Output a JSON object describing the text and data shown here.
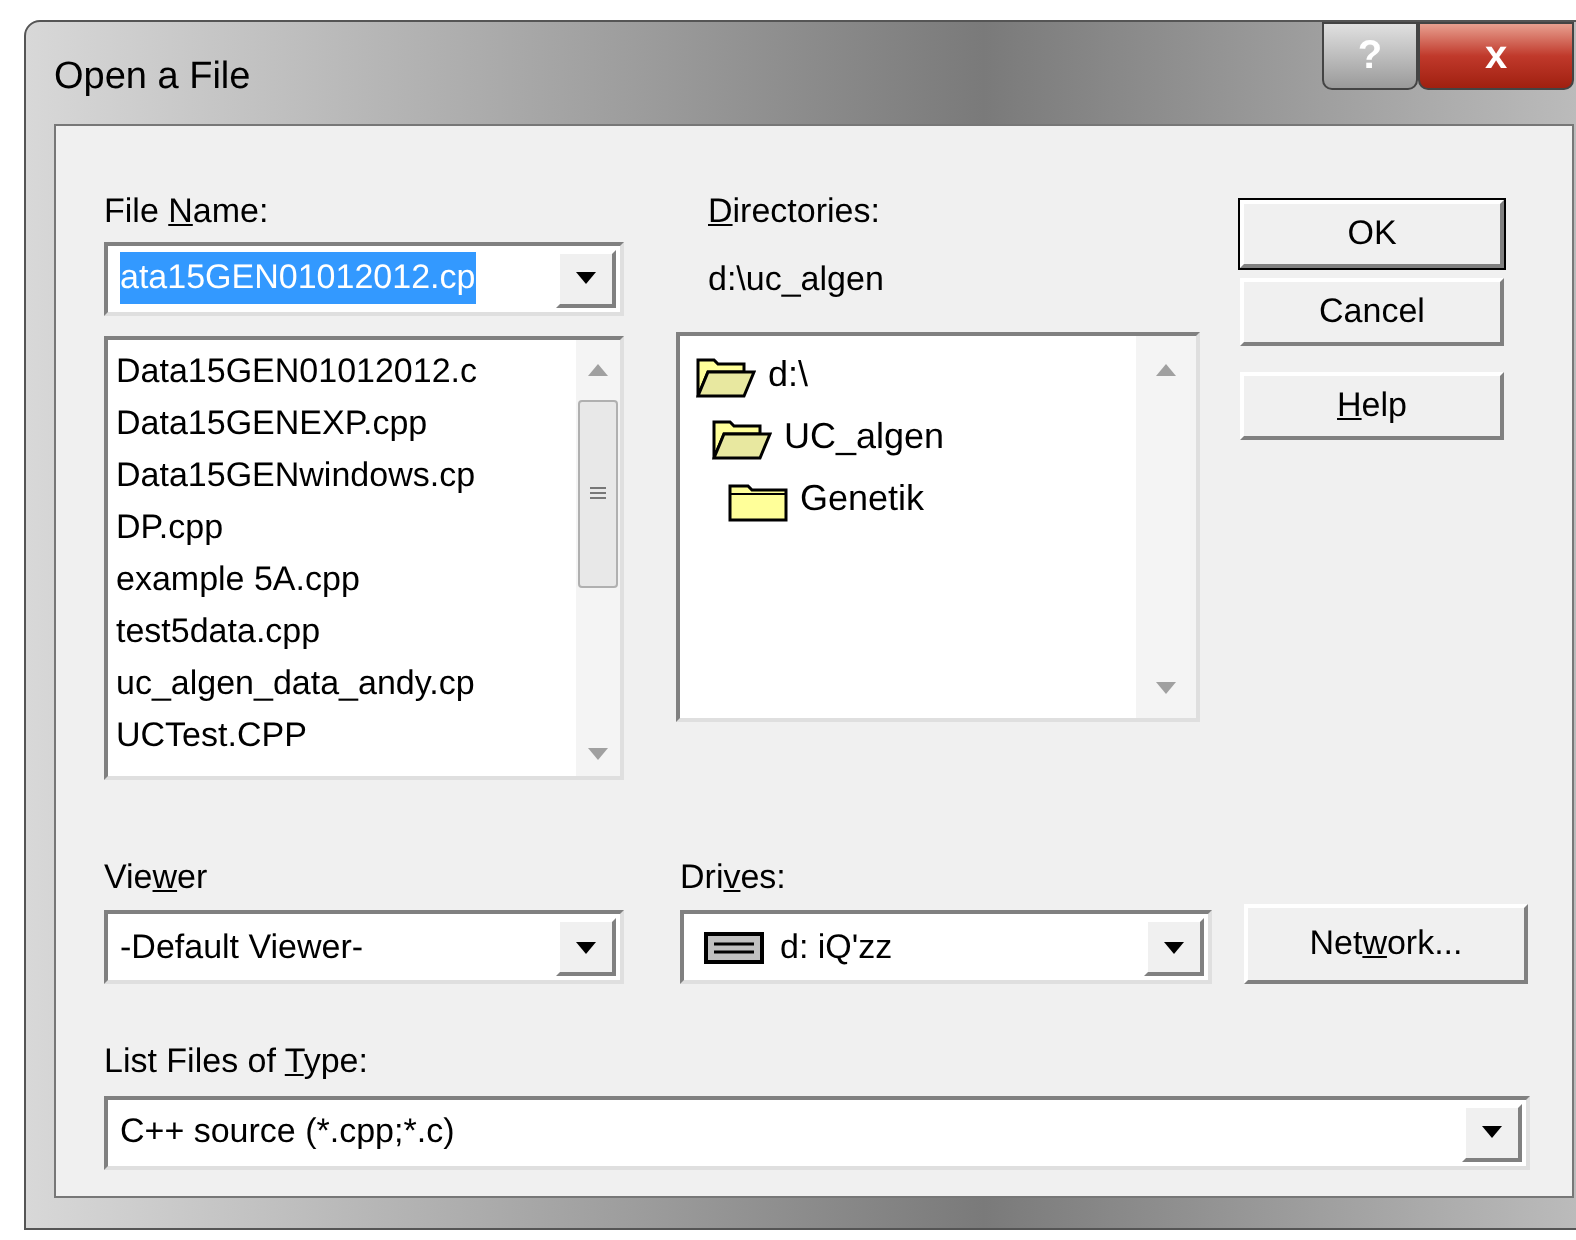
{
  "window": {
    "title": "Open a File",
    "title_buttons": [
      {
        "kind": "help",
        "label": "?"
      },
      {
        "kind": "close",
        "label": "x"
      }
    ]
  },
  "file_name": {
    "label": {
      "pre": "File ",
      "key": "N",
      "post": "ame:"
    },
    "value": "ata15GEN01012012.cp",
    "selected": true
  },
  "files": [
    {
      "name": "Data15GEN01012012.c",
      "selected": false
    },
    {
      "name": "Data15GENEXP.cpp",
      "selected": false
    },
    {
      "name": "Data15GENwindows.cp",
      "selected": false
    },
    {
      "name": "DP.cpp",
      "selected": false
    },
    {
      "name": "example 5A.cpp",
      "selected": false
    },
    {
      "name": "test5data.cpp",
      "selected": false
    },
    {
      "name": "uc_algen_data_andy.cp",
      "selected": false
    },
    {
      "name": "UCTest.CPP",
      "selected": false
    }
  ],
  "directories": {
    "label": {
      "key": "D",
      "post": "irectories:"
    },
    "path": "d:\\uc_algen",
    "tree": [
      {
        "name": "d:\\",
        "expanded": true,
        "children": [
          {
            "name": "UC_algen",
            "expanded": true,
            "children": [
              {
                "name": "Genetik",
                "expanded": false
              }
            ]
          }
        ]
      }
    ]
  },
  "buttons": [
    {
      "label": {
        "post": "OK"
      },
      "default": true
    },
    {
      "label": {
        "post": "Cancel"
      },
      "default": false
    },
    {
      "label": {
        "key": "H",
        "post": "elp"
      },
      "default": false
    }
  ],
  "viewer": {
    "label": {
      "pre": "Vie",
      "key": "w",
      "post": "er"
    },
    "value": "-Default Viewer-"
  },
  "drives": {
    "label": {
      "pre": "Dri",
      "key": "v",
      "post": "es:"
    },
    "value": "d: iQ'zz"
  },
  "network_button": {
    "label": {
      "pre": "Net",
      "key": "w",
      "post": "ork..."
    }
  },
  "file_type": {
    "label": {
      "pre": "List Files of ",
      "key": "T",
      "post": "ype:"
    },
    "value": "C++ source (*.cpp;*.c)"
  }
}
